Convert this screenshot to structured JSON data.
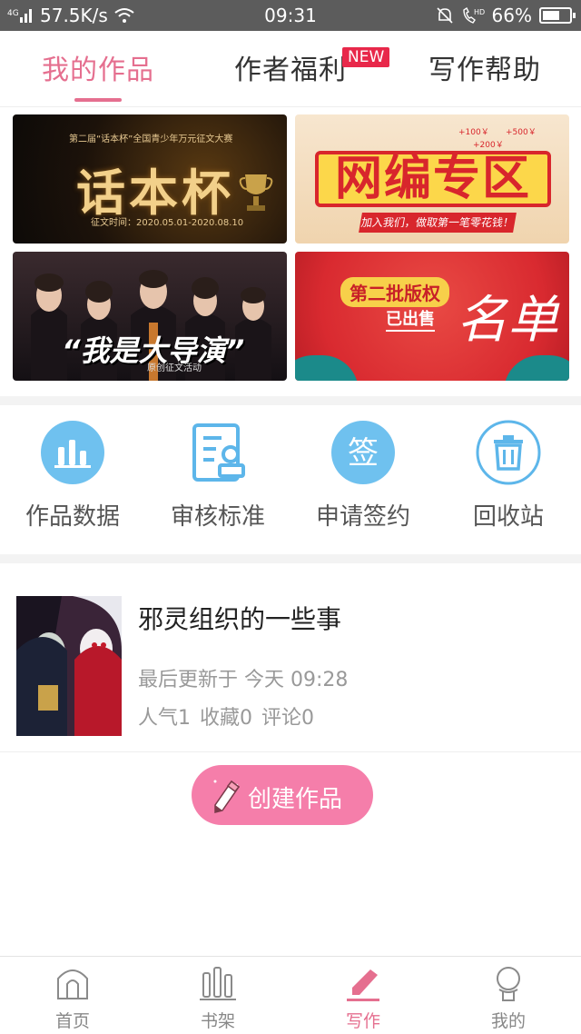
{
  "status_bar": {
    "network": "4G",
    "speed": "57.5K/s",
    "time": "09:31",
    "battery": "66%",
    "battery_level": 0.66
  },
  "tabs": [
    {
      "label": "我的作品",
      "active": true
    },
    {
      "label": "作者福利",
      "active": false
    },
    {
      "label": "写作帮助",
      "active": false
    }
  ],
  "new_badge": "NEW",
  "banners": {
    "b1": {
      "sub": "第二届“话本杯”全国青少年万元征文大赛",
      "big": "话本杯",
      "date": "征文时间：2020.05.01-2020.08.10"
    },
    "b2": {
      "big": "网编专区",
      "strip": "加入我们，做取第一笔零花钱！",
      "coins": [
        "+100￥",
        "+200￥",
        "+500￥"
      ]
    },
    "b3": {
      "big": "“我是大导演”",
      "small": "原创征文活动"
    },
    "b4": {
      "tag": "第二批版权",
      "sub": "已出售",
      "big": "名单"
    }
  },
  "shortcuts": [
    {
      "label": "作品数据",
      "icon": "bar-chart-icon"
    },
    {
      "label": "审核标准",
      "icon": "document-stamp-icon"
    },
    {
      "label": "申请签约",
      "icon": "sign-icon",
      "icon_text": "签"
    },
    {
      "label": "回收站",
      "icon": "trash-icon"
    }
  ],
  "work": {
    "title": "邪灵组织的一些事",
    "updated": "最后更新于 今天 09:28",
    "popularity": "人气1",
    "favorites": "收藏0",
    "comments": "评论0"
  },
  "create_button": {
    "label": "创建作品"
  },
  "bottom_nav": [
    {
      "label": "首页",
      "icon": "home-icon",
      "active": false
    },
    {
      "label": "书架",
      "icon": "bookshelf-icon",
      "active": false
    },
    {
      "label": "写作",
      "icon": "pencil-icon",
      "active": true
    },
    {
      "label": "我的",
      "icon": "user-icon",
      "active": false
    }
  ],
  "colors": {
    "accent": "#e56f8f",
    "badge": "#e8284a",
    "icon_blue": "#5db6ea",
    "create_button": "#f57eaa"
  }
}
